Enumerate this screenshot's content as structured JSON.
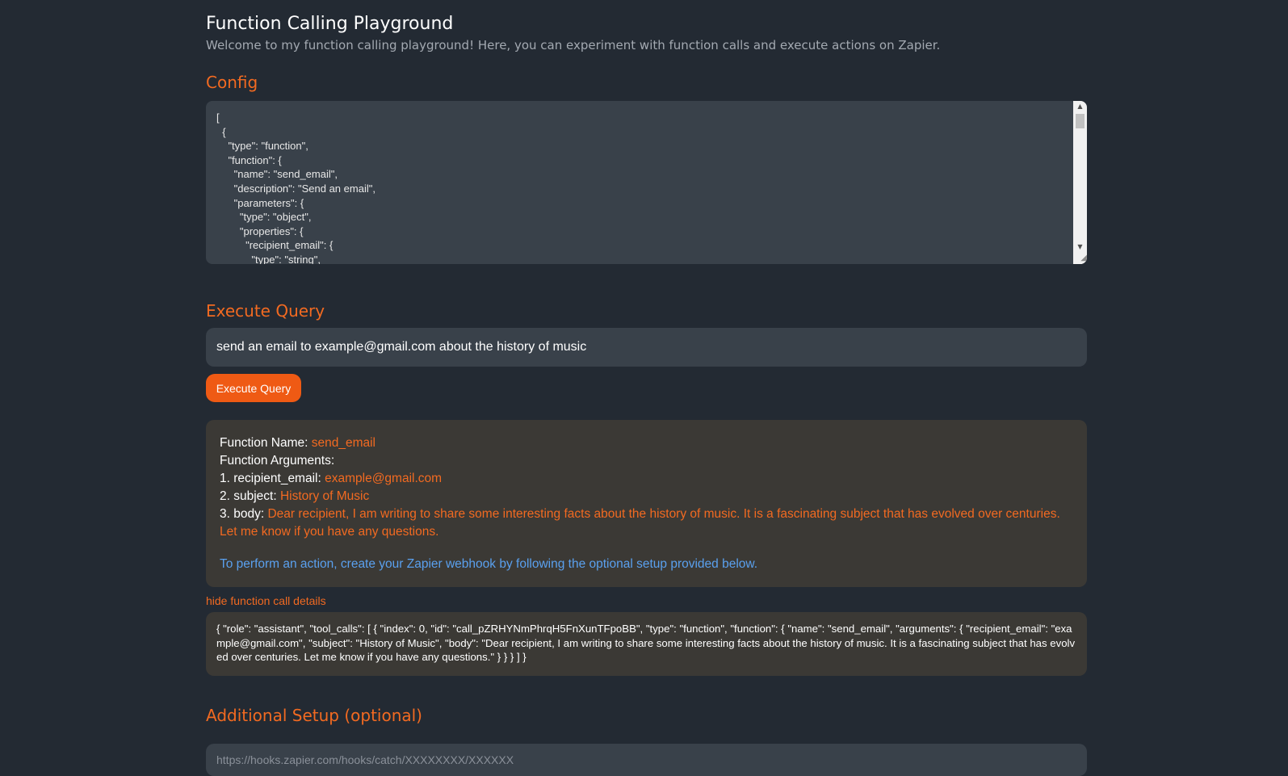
{
  "page": {
    "title": "Function Calling Playground",
    "subtitle": "Welcome to my function calling playground! Here, you can experiment with function calls and execute actions on Zapier."
  },
  "config": {
    "heading": "Config",
    "json_text": "[\n  {\n    \"type\": \"function\",\n    \"function\": {\n      \"name\": \"send_email\",\n      \"description\": \"Send an email\",\n      \"parameters\": {\n        \"type\": \"object\",\n        \"properties\": {\n          \"recipient_email\": {\n            \"type\": \"string\","
  },
  "query": {
    "heading": "Execute Query",
    "value": "send an email to example@gmail.com about the history of music",
    "button_label": "Execute Query"
  },
  "result": {
    "function_name_label": "Function Name:",
    "function_name": "send_email",
    "arguments_label": "Function Arguments:",
    "arguments": [
      {
        "label": "1. recipient_email:",
        "value": "example@gmail.com"
      },
      {
        "label": "2. subject:",
        "value": "History of Music"
      },
      {
        "label": "3. body:",
        "value": "Dear recipient, I am writing to share some interesting facts about the history of music. It is a fascinating subject that has evolved over centuries. Let me know if you have any questions."
      }
    ],
    "note": "To perform an action, create your Zapier webhook by following the optional setup provided below."
  },
  "details": {
    "toggle_label": "hide function call details",
    "raw": "{ \"role\": \"assistant\", \"tool_calls\": [ { \"index\": 0, \"id\": \"call_pZRHYNmPhrqH5FnXunTFpoBB\", \"type\": \"function\", \"function\": { \"name\": \"send_email\", \"arguments\": { \"recipient_email\": \"example@gmail.com\", \"subject\": \"History of Music\", \"body\": \"Dear recipient, I am writing to share some interesting facts about the history of music. It is a fascinating subject that has evolved over centuries. Let me know if you have any questions.\" } } } ] }"
  },
  "setup": {
    "heading": "Additional Setup (optional)",
    "webhook_placeholder": "https://hooks.zapier.com/hooks/catch/XXXXXXXX/XXXXXX"
  },
  "colors": {
    "background": "#232a33",
    "accent": "#f26a21",
    "link_blue": "#5aa0ee",
    "panel": "#3b3935",
    "input": "#39414a"
  }
}
